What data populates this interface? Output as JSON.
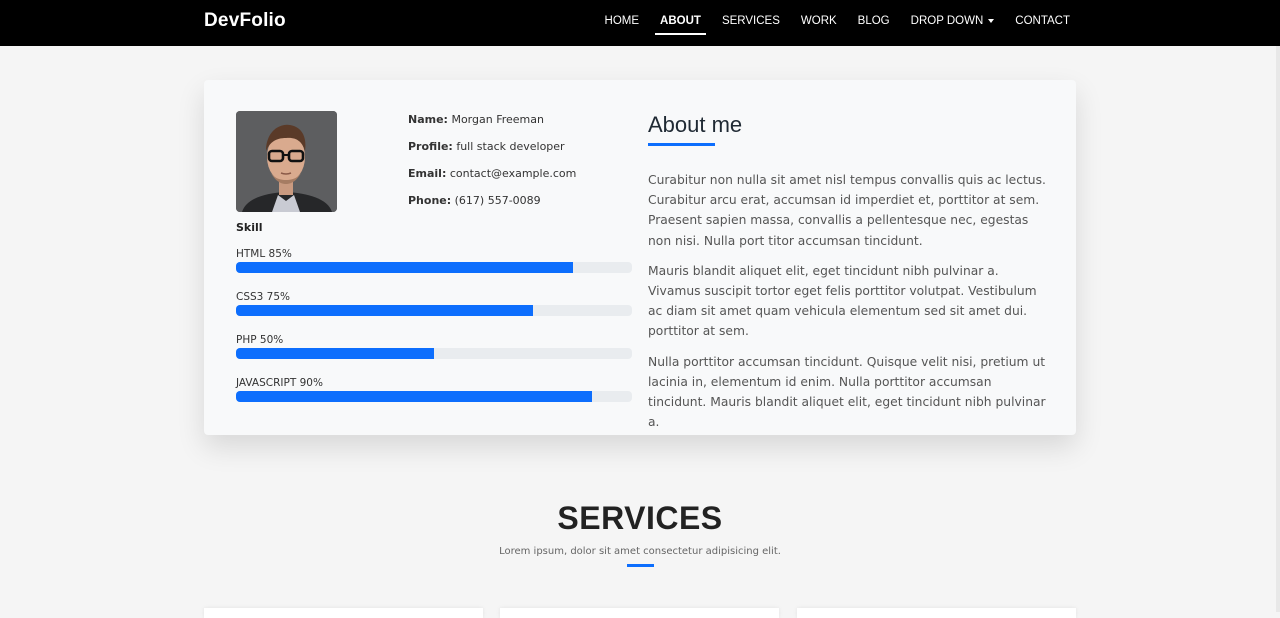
{
  "brand": "DevFolio",
  "nav": [
    {
      "label": "HOME",
      "active": false
    },
    {
      "label": "ABOUT",
      "active": true
    },
    {
      "label": "SERVICES",
      "active": false
    },
    {
      "label": "WORK",
      "active": false
    },
    {
      "label": "BLOG",
      "active": false
    },
    {
      "label": "DROP DOWN",
      "active": false
    },
    {
      "label": "CONTACT",
      "active": false
    }
  ],
  "profile": {
    "name_label": "Name:",
    "name": "Morgan Freeman",
    "profile_label": "Profile:",
    "profile": "full stack developer",
    "email_label": "Email:",
    "email": "contact@example.com",
    "phone_label": "Phone:",
    "phone": "(617) 557-0089"
  },
  "skill_title": "Skill",
  "skills": [
    {
      "label": "HTML 85%",
      "percent": 85
    },
    {
      "label": "CSS3 75%",
      "percent": 75
    },
    {
      "label": "PHP 50%",
      "percent": 50
    },
    {
      "label": "JAVASCRIPT 90%",
      "percent": 90
    }
  ],
  "about": {
    "title": "About me",
    "paragraphs": [
      "Curabitur non nulla sit amet nisl tempus convallis quis ac lectus. Curabitur arcu erat, accumsan id imperdiet et, porttitor at sem. Praesent sapien massa, convallis a pellentesque nec, egestas non nisi. Nulla port titor accumsan tincidunt.",
      "Mauris blandit aliquet elit, eget tincidunt nibh pulvinar a. Vivamus suscipit tortor eget felis porttitor volutpat. Vestibulum ac diam sit amet quam vehicula elementum sed sit amet dui. porttitor at sem.",
      "Nulla porttitor accumsan tincidunt. Quisque velit nisi, pretium ut lacinia in, elementum id enim. Nulla porttitor accumsan tincidunt. Mauris blandit aliquet elit, eget tincidunt nibh pulvinar a."
    ]
  },
  "services": {
    "title": "SERVICES",
    "subtitle": "Lorem ipsum, dolor sit amet consectetur adipisicing elit."
  },
  "colors": {
    "accent": "#0d6efd",
    "navbar": "#000000",
    "background": "#f5f5f5"
  }
}
